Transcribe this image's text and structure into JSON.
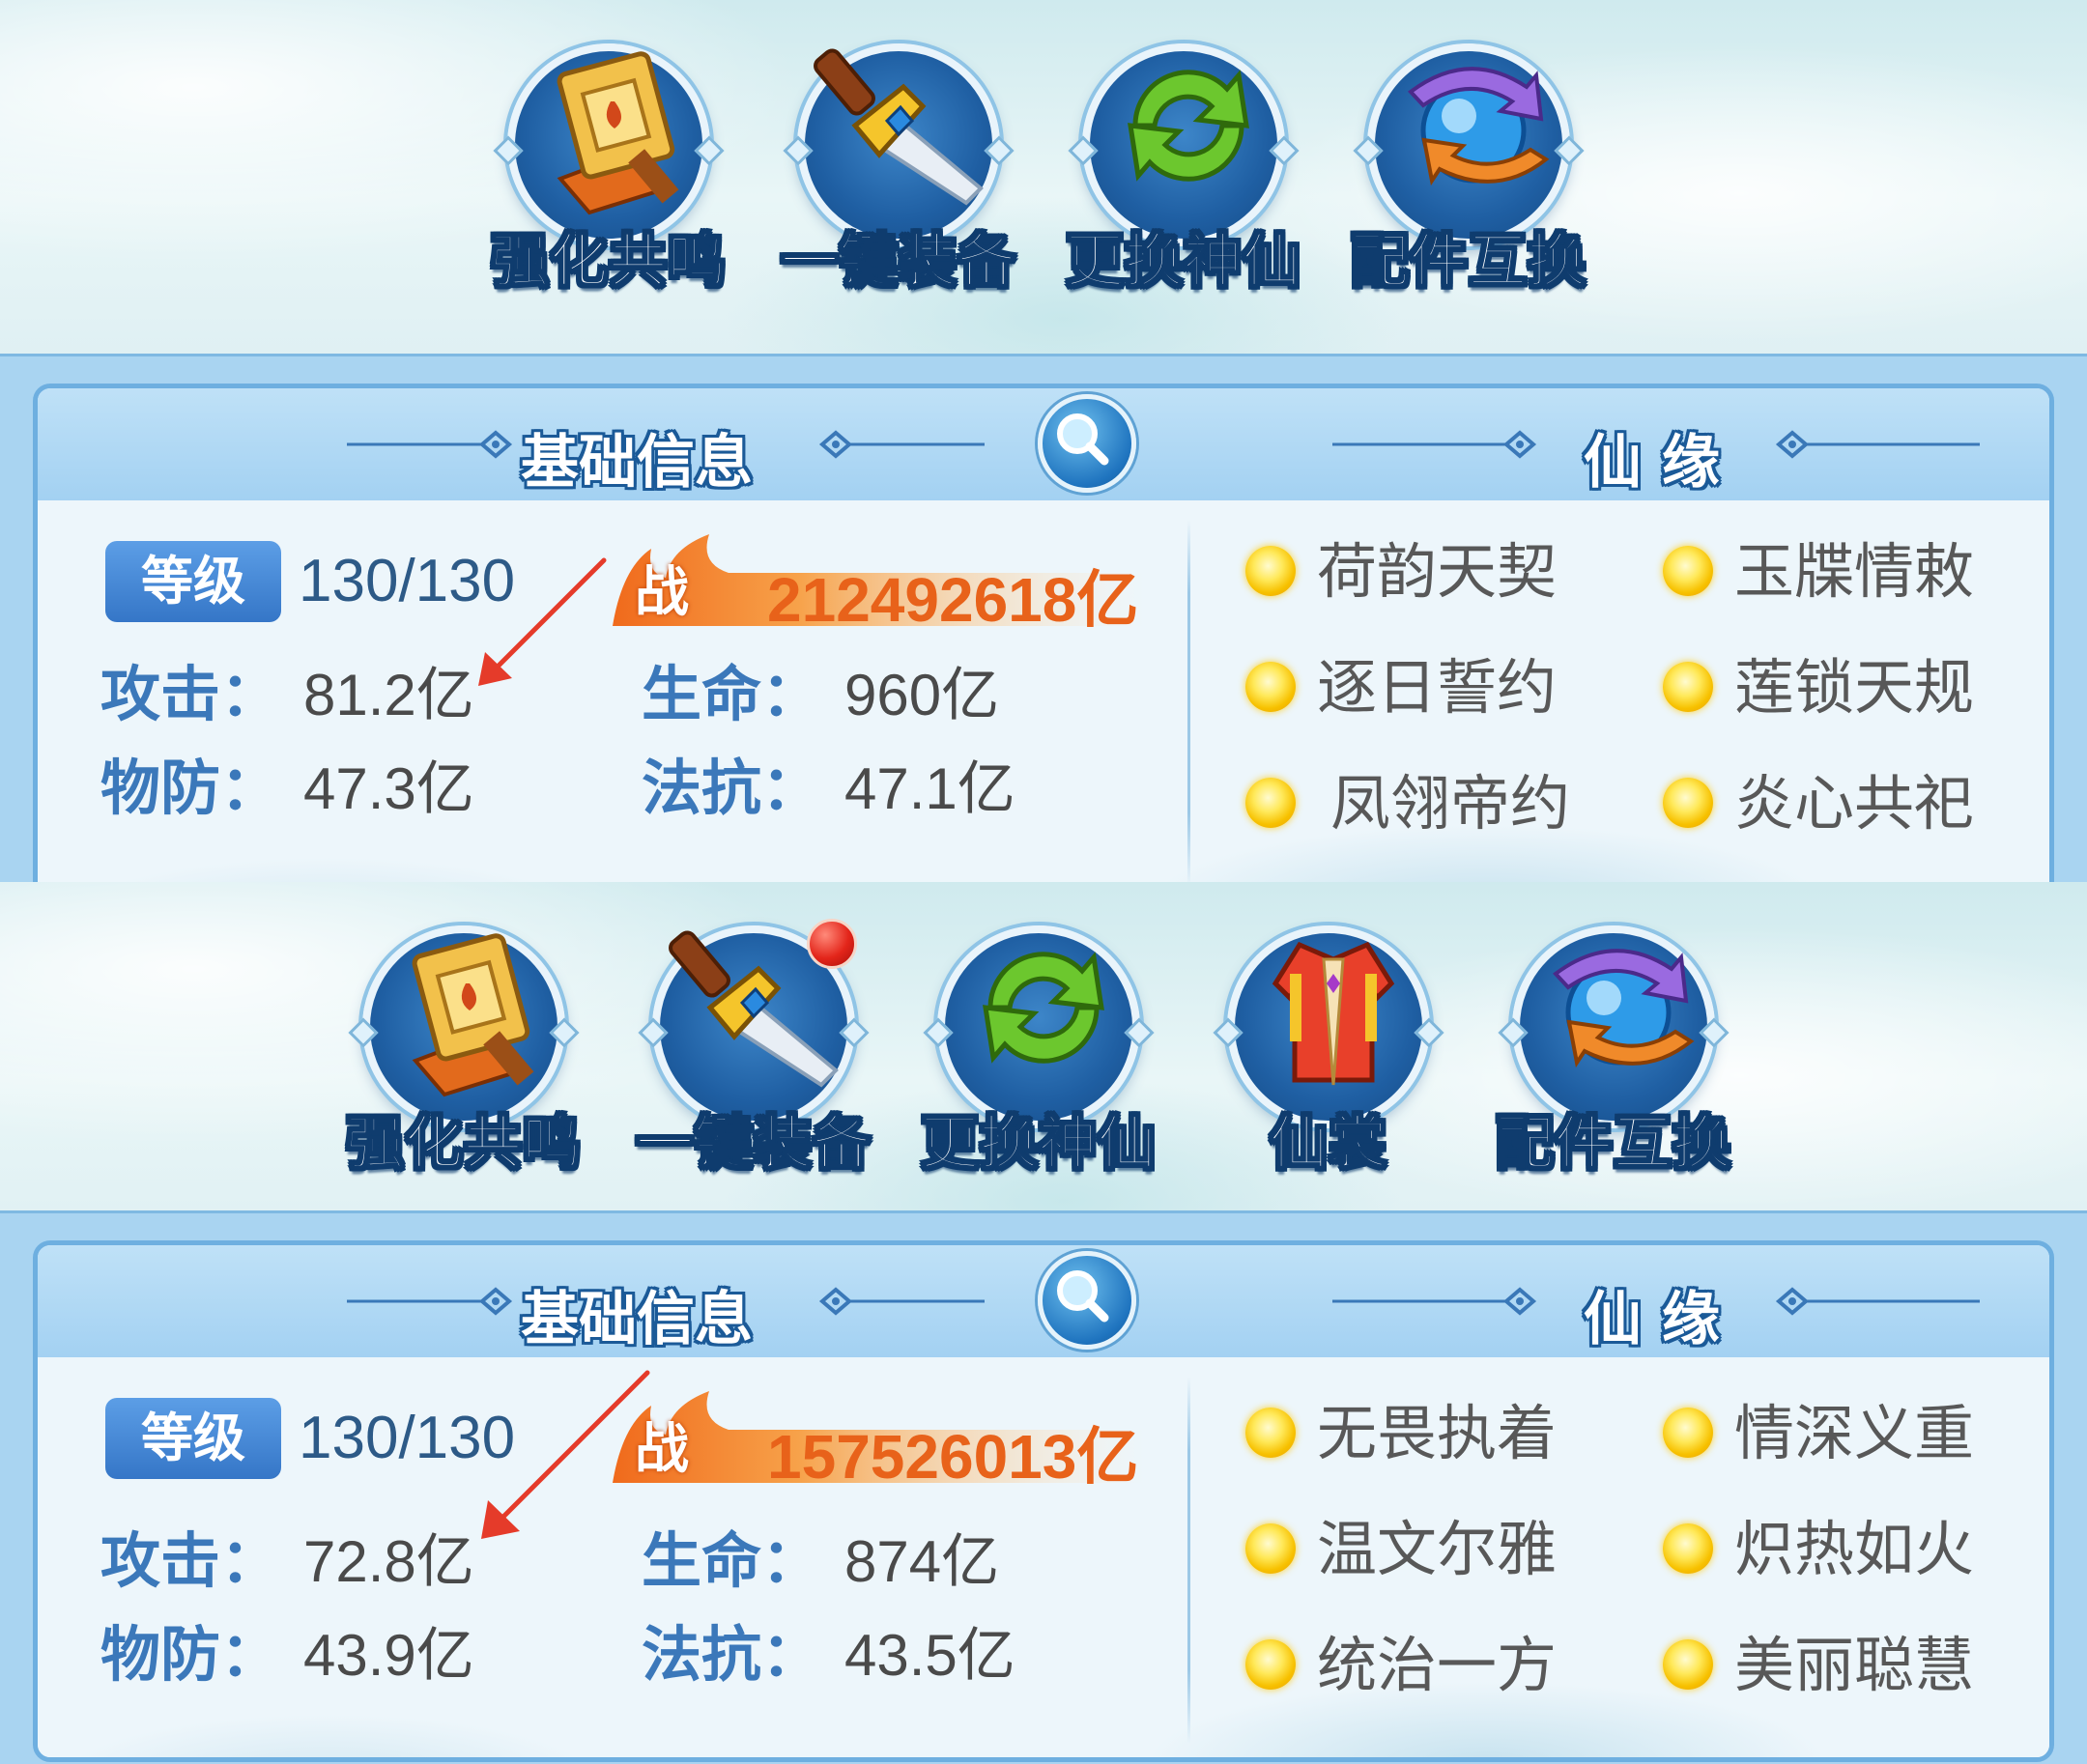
{
  "screens": [
    {
      "toolbar": [
        {
          "label": "强化共鸣",
          "icon": "hammer-scroll-icon",
          "badge": false
        },
        {
          "label": "一键装备",
          "icon": "sword-icon",
          "badge": false
        },
        {
          "label": "更换神仙",
          "icon": "swap-arrows-icon",
          "badge": false
        },
        {
          "label": "配件互换",
          "icon": "orb-exchange-icon",
          "badge": false
        }
      ],
      "panel": {
        "basic_title": "基础信息",
        "bond_title": "仙 缘",
        "level_label": "等级",
        "level_value": "130/130",
        "power_char": "战",
        "power_value": "212492618亿",
        "stats": {
          "attack_label": "攻击：",
          "attack_value": "81.2亿",
          "hp_label": "生命：",
          "hp_value": "960亿",
          "pdef_label": "物防：",
          "pdef_value": "47.3亿",
          "mres_label": "法抗：",
          "mres_value": "47.1亿"
        },
        "bonds": [
          "荷韵天契",
          "玉牒情敕",
          "逐日誓约",
          "莲锁天规",
          "凤翎帝约",
          "炎心共祀"
        ]
      }
    },
    {
      "toolbar": [
        {
          "label": "强化共鸣",
          "icon": "hammer-scroll-icon",
          "badge": false
        },
        {
          "label": "一键装备",
          "icon": "sword-icon",
          "badge": true
        },
        {
          "label": "更换神仙",
          "icon": "swap-arrows-icon",
          "badge": false
        },
        {
          "label": "仙裳",
          "icon": "robe-icon",
          "badge": false
        },
        {
          "label": "配件互换",
          "icon": "orb-exchange-icon",
          "badge": false
        }
      ],
      "panel": {
        "basic_title": "基础信息",
        "bond_title": "仙 缘",
        "level_label": "等级",
        "level_value": "130/130",
        "power_char": "战",
        "power_value": "157526013亿",
        "stats": {
          "attack_label": "攻击：",
          "attack_value": "72.8亿",
          "hp_label": "生命：",
          "hp_value": "874亿",
          "pdef_label": "物防：",
          "pdef_value": "43.9亿",
          "mres_label": "法抗：",
          "mres_value": "43.5亿"
        },
        "bonds": [
          "无畏执着",
          "情深义重",
          "温文尔雅",
          "炽热如火",
          "统治一方",
          "美丽聪慧"
        ]
      }
    }
  ],
  "colors": {
    "accent_blue": "#3576c7",
    "power_orange": "#e8621a",
    "annotation_red": "#e53b2a"
  }
}
